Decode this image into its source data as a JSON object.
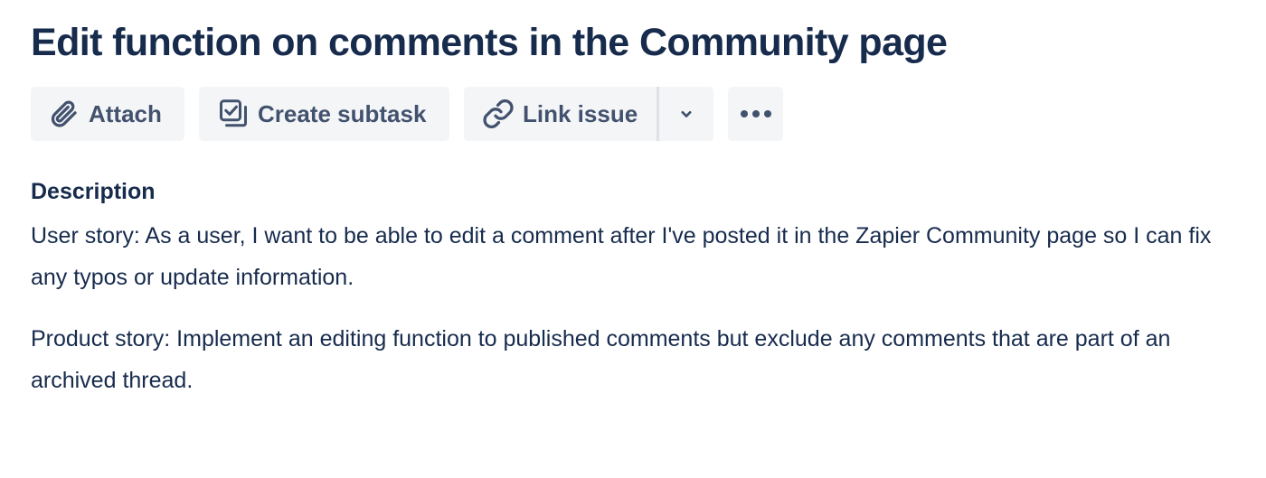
{
  "issue": {
    "title": "Edit function on comments in the Community page"
  },
  "toolbar": {
    "attach_label": "Attach",
    "attach_icon": "paperclip-icon",
    "create_subtask_label": "Create subtask",
    "create_subtask_icon": "subtask-icon",
    "link_issue_label": "Link issue",
    "link_issue_icon": "link-icon",
    "dropdown_icon": "chevron-down-icon",
    "more_icon": "more-horizontal-icon"
  },
  "description": {
    "heading": "Description",
    "paragraphs": [
      "User story: As a user, I want to be able to edit a comment after I've posted it in the Zapier Community page so I can fix any typos or update information.",
      "Product story: Implement an editing function to published comments but exclude any comments that are part of an archived thread."
    ]
  },
  "colors": {
    "text_primary": "#172b4d",
    "button_text": "#42526e",
    "button_bg": "#f4f5f7",
    "divider": "#dfe1e6"
  }
}
